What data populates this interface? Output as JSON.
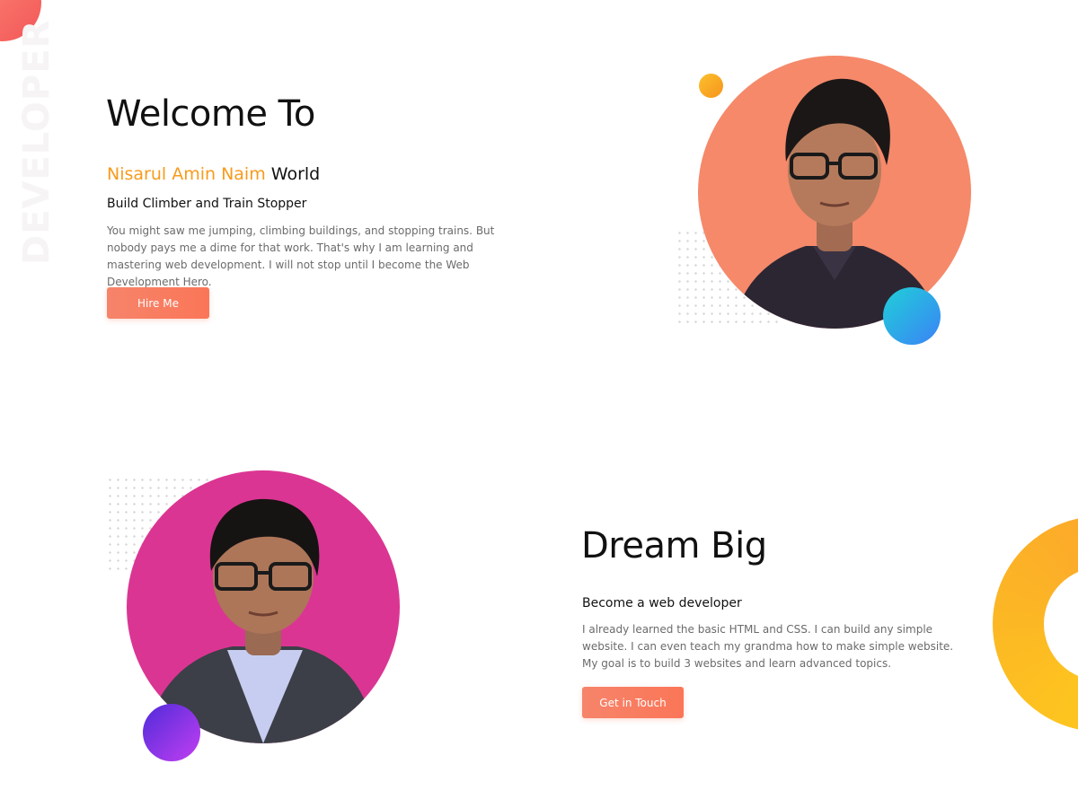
{
  "side_label": "DEVELOPER",
  "hero": {
    "title": "Welcome To",
    "name": "Nisarul Amin Naim",
    "name_suffix": "World",
    "tagline": "Build Climber and Train Stopper",
    "body": "You might saw me jumping, climbing buildings, and stopping trains. But nobody pays me a dime for that work. That's why I am learning and mastering web development. I will not stop until I become the Web Development Hero.",
    "button_label": "Hire Me"
  },
  "about": {
    "title": "Dream Big",
    "subtitle": "Become a web developer",
    "body": "I already learned the basic HTML and CSS. I can build any simple website. I can even teach my grandma how to make simple website. My goal is to build 3 websites and learn advanced topics.",
    "button_label": "Get in Touch"
  },
  "colors": {
    "accent_orange": "#f79b1c",
    "button": "#f97a5d",
    "hero_portrait_bg": "#f5896a",
    "about_portrait_bg": "#db3593"
  },
  "icons": {
    "hero_portrait": "person-portrait-icon",
    "about_portrait": "person-portrait-icon"
  }
}
